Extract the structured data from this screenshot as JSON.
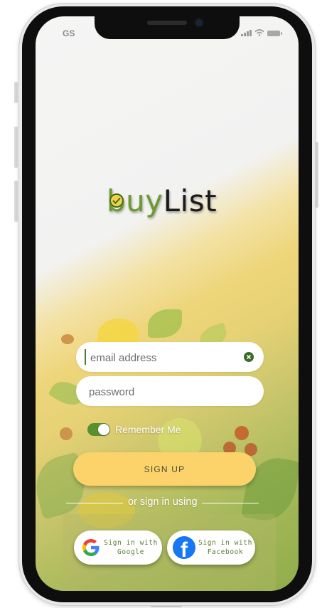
{
  "status_bar": {
    "carrier": "GS"
  },
  "logo": {
    "part_a": "buy",
    "part_b": "List"
  },
  "form": {
    "email": {
      "placeholder": "email address",
      "value": ""
    },
    "password": {
      "placeholder": "password",
      "value": ""
    },
    "remember_me": {
      "label": "Remember Me",
      "on": true
    },
    "signup_label": "SIGN UP"
  },
  "divider": {
    "label": "or sign in using"
  },
  "social": {
    "google": {
      "line1": "Sign in with",
      "line2": "Google"
    },
    "facebook": {
      "line1": "Sign in with",
      "line2": "Facebook"
    }
  },
  "colors": {
    "brand_green": "#6b9b2f",
    "toggle_green": "#5a8f2e",
    "button_yellow": "#fcd36a",
    "facebook_blue": "#1877f2"
  },
  "icons": [
    "wifi-icon",
    "cellular-signal-icon",
    "battery-icon",
    "checkmark-icon",
    "clear-icon",
    "google-icon",
    "facebook-icon"
  ]
}
